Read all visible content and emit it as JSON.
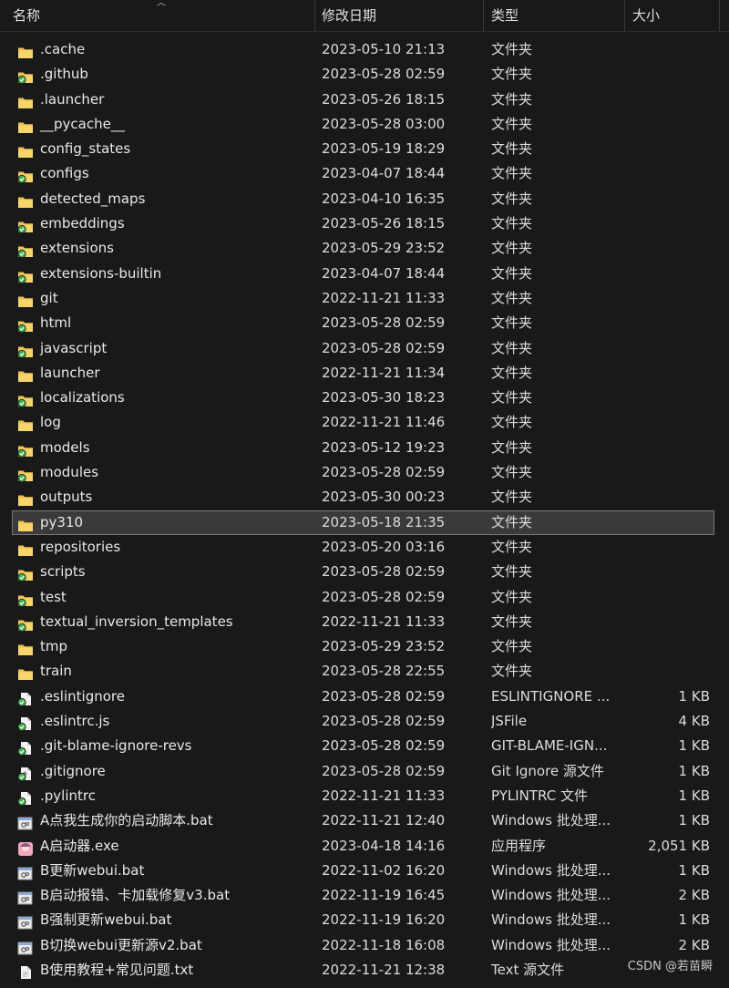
{
  "header": {
    "name": "名称",
    "date": "修改日期",
    "type": "类型",
    "size": "大小"
  },
  "files": [
    {
      "name": ".cache",
      "date": "2023-05-10 21:13",
      "type": "文件夹",
      "size": "",
      "icon": "folder-icon"
    },
    {
      "name": ".github",
      "date": "2023-05-28 02:59",
      "type": "文件夹",
      "size": "",
      "icon": "folder-synced-icon"
    },
    {
      "name": ".launcher",
      "date": "2023-05-26 18:15",
      "type": "文件夹",
      "size": "",
      "icon": "folder-icon"
    },
    {
      "name": "__pycache__",
      "date": "2023-05-28 03:00",
      "type": "文件夹",
      "size": "",
      "icon": "folder-icon"
    },
    {
      "name": "config_states",
      "date": "2023-05-19 18:29",
      "type": "文件夹",
      "size": "",
      "icon": "folder-icon"
    },
    {
      "name": "configs",
      "date": "2023-04-07 18:44",
      "type": "文件夹",
      "size": "",
      "icon": "folder-synced-icon"
    },
    {
      "name": "detected_maps",
      "date": "2023-04-10 16:35",
      "type": "文件夹",
      "size": "",
      "icon": "folder-icon"
    },
    {
      "name": "embeddings",
      "date": "2023-05-26 18:15",
      "type": "文件夹",
      "size": "",
      "icon": "folder-synced-icon"
    },
    {
      "name": "extensions",
      "date": "2023-05-29 23:52",
      "type": "文件夹",
      "size": "",
      "icon": "folder-synced-icon"
    },
    {
      "name": "extensions-builtin",
      "date": "2023-04-07 18:44",
      "type": "文件夹",
      "size": "",
      "icon": "folder-synced-icon"
    },
    {
      "name": "git",
      "date": "2022-11-21 11:33",
      "type": "文件夹",
      "size": "",
      "icon": "folder-icon"
    },
    {
      "name": "html",
      "date": "2023-05-28 02:59",
      "type": "文件夹",
      "size": "",
      "icon": "folder-synced-icon"
    },
    {
      "name": "javascript",
      "date": "2023-05-28 02:59",
      "type": "文件夹",
      "size": "",
      "icon": "folder-synced-icon"
    },
    {
      "name": "launcher",
      "date": "2022-11-21 11:34",
      "type": "文件夹",
      "size": "",
      "icon": "folder-icon"
    },
    {
      "name": "localizations",
      "date": "2023-05-30 18:23",
      "type": "文件夹",
      "size": "",
      "icon": "folder-synced-icon"
    },
    {
      "name": "log",
      "date": "2022-11-21 11:46",
      "type": "文件夹",
      "size": "",
      "icon": "folder-icon"
    },
    {
      "name": "models",
      "date": "2023-05-12 19:23",
      "type": "文件夹",
      "size": "",
      "icon": "folder-synced-icon"
    },
    {
      "name": "modules",
      "date": "2023-05-28 02:59",
      "type": "文件夹",
      "size": "",
      "icon": "folder-synced-icon"
    },
    {
      "name": "outputs",
      "date": "2023-05-30 00:23",
      "type": "文件夹",
      "size": "",
      "icon": "folder-icon"
    },
    {
      "name": "py310",
      "date": "2023-05-18 21:35",
      "type": "文件夹",
      "size": "",
      "icon": "folder-icon",
      "selected": true
    },
    {
      "name": "repositories",
      "date": "2023-05-20 03:16",
      "type": "文件夹",
      "size": "",
      "icon": "folder-icon"
    },
    {
      "name": "scripts",
      "date": "2023-05-28 02:59",
      "type": "文件夹",
      "size": "",
      "icon": "folder-synced-icon"
    },
    {
      "name": "test",
      "date": "2023-05-28 02:59",
      "type": "文件夹",
      "size": "",
      "icon": "folder-synced-icon"
    },
    {
      "name": "textual_inversion_templates",
      "date": "2022-11-21 11:33",
      "type": "文件夹",
      "size": "",
      "icon": "folder-synced-icon"
    },
    {
      "name": "tmp",
      "date": "2023-05-29 23:52",
      "type": "文件夹",
      "size": "",
      "icon": "folder-icon"
    },
    {
      "name": "train",
      "date": "2023-05-28 22:55",
      "type": "文件夹",
      "size": "",
      "icon": "folder-icon"
    },
    {
      "name": ".eslintignore",
      "date": "2023-05-28 02:59",
      "type": "ESLINTIGNORE ...",
      "size": "1 KB",
      "icon": "file-synced-icon"
    },
    {
      "name": ".eslintrc.js",
      "date": "2023-05-28 02:59",
      "type": "JSFile",
      "size": "4 KB",
      "icon": "file-synced-icon"
    },
    {
      "name": ".git-blame-ignore-revs",
      "date": "2023-05-28 02:59",
      "type": "GIT-BLAME-IGN...",
      "size": "1 KB",
      "icon": "file-synced-icon"
    },
    {
      "name": ".gitignore",
      "date": "2023-05-28 02:59",
      "type": "Git Ignore 源文件",
      "size": "1 KB",
      "icon": "gitignore-file-icon"
    },
    {
      "name": ".pylintrc",
      "date": "2022-11-21 11:33",
      "type": "PYLINTRC 文件",
      "size": "1 KB",
      "icon": "file-synced-icon"
    },
    {
      "name": "A点我生成你的启动脚本.bat",
      "date": "2022-11-21 12:40",
      "type": "Windows 批处理...",
      "size": "1 KB",
      "icon": "batch-file-icon"
    },
    {
      "name": "A启动器.exe",
      "date": "2023-04-18 14:16",
      "type": "应用程序",
      "size": "2,051 KB",
      "icon": "exe-app-icon"
    },
    {
      "name": "B更新webui.bat",
      "date": "2022-11-02 16:20",
      "type": "Windows 批处理...",
      "size": "1 KB",
      "icon": "batch-file-icon"
    },
    {
      "name": "B启动报错、卡加载修复v3.bat",
      "date": "2022-11-19 16:45",
      "type": "Windows 批处理...",
      "size": "2 KB",
      "icon": "batch-file-icon"
    },
    {
      "name": "B强制更新webui.bat",
      "date": "2022-11-19 16:20",
      "type": "Windows 批处理...",
      "size": "1 KB",
      "icon": "batch-file-icon"
    },
    {
      "name": "B切换webui更新源v2.bat",
      "date": "2022-11-18 16:08",
      "type": "Windows 批处理...",
      "size": "2 KB",
      "icon": "batch-file-icon"
    },
    {
      "name": "B使用教程+常见问题.txt",
      "date": "2022-11-21 12:38",
      "type": "Text 源文件",
      "size": "",
      "icon": "text-file-icon"
    }
  ],
  "watermark": "CSDN @若苗瞬",
  "colors": {
    "folder": "#f2c14e",
    "sync": "#3fb34f",
    "selected_bg": "#3a3a3a"
  }
}
